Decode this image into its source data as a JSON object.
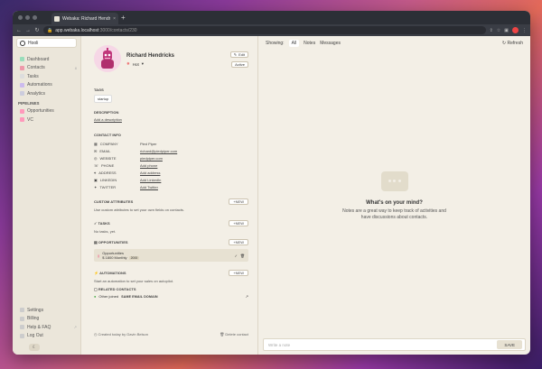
{
  "browser": {
    "tab_title": "Webaka: Richard Hendricks",
    "tab_close": "×",
    "new_tab": "+",
    "url_main": "app.webaka.localhost",
    "url_rest": ":3000/contacts/230"
  },
  "sidebar": {
    "workspace": "Hooli",
    "items": [
      {
        "label": "Dashboard",
        "count": ""
      },
      {
        "label": "Contacts",
        "count": "8"
      },
      {
        "label": "Tasks",
        "count": ""
      },
      {
        "label": "Automations",
        "count": ""
      },
      {
        "label": "Analytics",
        "count": ""
      }
    ],
    "pipelines_label": "Pipelines",
    "pipelines": [
      {
        "label": "Opportunities"
      },
      {
        "label": "VC"
      }
    ],
    "bottom": [
      {
        "label": "Settings"
      },
      {
        "label": "Billing"
      },
      {
        "label": "Help & FAQ"
      },
      {
        "label": "Log Out"
      }
    ]
  },
  "contact": {
    "name": "Richard Hendricks",
    "status": "Hot",
    "edit_label": "Edit",
    "active_label": "Active",
    "tags_label": "Tags",
    "tag": "startup",
    "description_label": "Description",
    "add_description": "Add a description",
    "contact_info_label": "Contact Info",
    "info": [
      {
        "key": "Company",
        "value": "Pied Piper",
        "link": false
      },
      {
        "key": "Email",
        "value": "richard@piedpiper.com",
        "link": true
      },
      {
        "key": "Website",
        "value": "piedpiper.com",
        "link": true
      },
      {
        "key": "Phone",
        "value": "Add phone",
        "link": true
      },
      {
        "key": "Address",
        "value": "Add address",
        "link": true
      },
      {
        "key": "LinkedIn",
        "value": "Add LinkedIn",
        "link": true
      },
      {
        "key": "Twitter",
        "value": "Add Twitter",
        "link": true
      }
    ],
    "custom_label": "Custom Attributes",
    "custom_desc": "Use custom attributes to set your own fields on contacts.",
    "new_label": "New",
    "tasks_label": "Tasks",
    "no_tasks": "No tasks, yet.",
    "opps_label": "Opportunities",
    "opp_name": "Opportunities",
    "opp_value": "$ 1800 Monthly",
    "opp_badge": "2000",
    "automations_label": "Automations",
    "automations_desc": "Start an automation to set your sales on autopilot.",
    "related_label": "Related Contacts",
    "related_text": "Other joined",
    "related_tag": "SAME EMAIL DOMAIN",
    "created": "Created today by Gavin Belson",
    "delete": "Delete contact"
  },
  "notes": {
    "showing": "Showing:",
    "tabs": [
      "All",
      "Notes",
      "Messages"
    ],
    "refresh": "Refresh",
    "empty_title": "What's on your mind?",
    "empty_line1": "Notes are a great way to keep track of activities and",
    "empty_line2": "have discussions about contacts.",
    "placeholder": "Write a note",
    "save": "SAVE"
  },
  "colors": {
    "accent": "#2c2f36",
    "hot": "#e77777"
  }
}
